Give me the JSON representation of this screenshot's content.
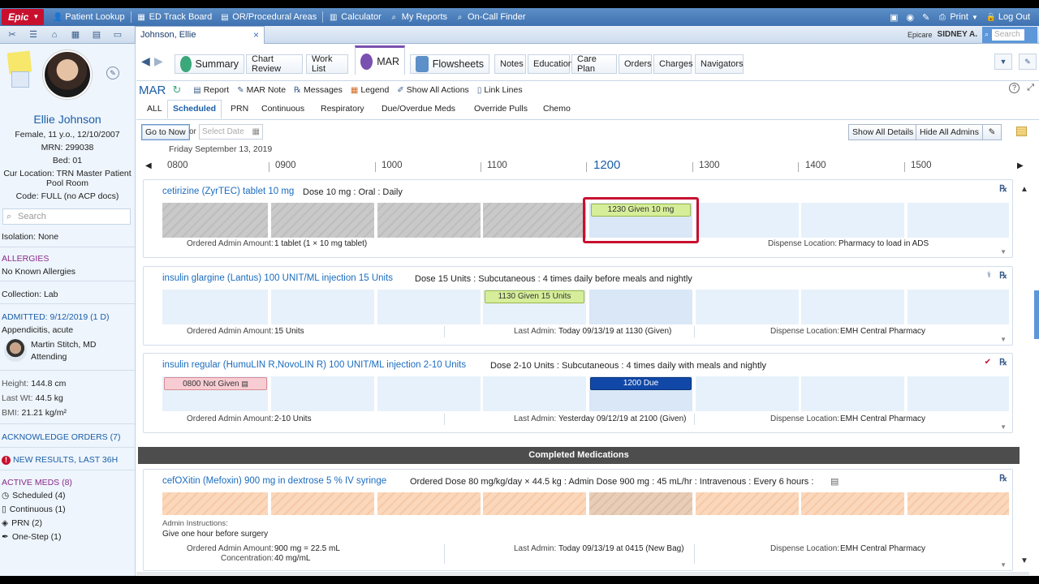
{
  "topbar": {
    "logo": "Epic",
    "items": [
      "Patient Lookup",
      "ED Track Board",
      "OR/Procedural Areas",
      "Calculator",
      "My Reports",
      "On-Call Finder"
    ],
    "print": "Print",
    "logout": "Log Out"
  },
  "tabbar": {
    "patient_tab": "Johnson, Ellie",
    "epicare": "Epicare",
    "user": "SIDNEY A.",
    "search_placeholder": "Search"
  },
  "sidebar": {
    "name": "Ellie Johnson",
    "demographics": "Female, 11 y.o., 12/10/2007",
    "mrn": "MRN: 299038",
    "bed": "Bed: 01",
    "location_line1": "Cur Location: TRN Master Patient",
    "location_line2": "Pool Room",
    "code": "Code: FULL (no ACP docs)",
    "search_placeholder": "Search",
    "isolation": "Isolation: None",
    "allergies_head": "ALLERGIES",
    "allergies": "No Known Allergies",
    "collection": "Collection: Lab",
    "admitted_head": "ADMITTED: 9/12/2019 (1 D)",
    "diagnosis": "Appendicitis, acute",
    "doctor": "Martin Stitch, MD",
    "doctor_role": "Attending",
    "height_label": "Height:",
    "height": "144.8 cm",
    "weight_label": "Last Wt:",
    "weight": "44.5 kg",
    "bmi_label": "BMI:",
    "bmi": "21.21 kg/m²",
    "ack_orders": "ACKNOWLEDGE ORDERS (7)",
    "new_results": "NEW RESULTS, LAST 36H",
    "active_meds_head": "ACTIVE MEDS (8)",
    "active_meds": [
      "Scheduled (4)",
      "Continuous (1)",
      "PRN (2)",
      "One-Step (1)"
    ]
  },
  "activity_tabs": [
    "Summary",
    "Chart Review",
    "Work List",
    "MAR",
    "Flowsheets",
    "Notes",
    "Education",
    "Care Plan",
    "Orders",
    "Charges",
    "Navigators"
  ],
  "mar_toolbar": {
    "title": "MAR",
    "items": [
      "Report",
      "MAR Note",
      "Messages",
      "Legend",
      "Show All Actions",
      "Link Lines"
    ]
  },
  "filter_tabs": [
    "ALL",
    "Scheduled",
    "PRN",
    "Continuous",
    "Respiratory",
    "Due/Overdue Meds",
    "Override Pulls",
    "Chemo"
  ],
  "controls": {
    "go_to_now": "Go to Now",
    "or": "or",
    "select_date": "Select Date",
    "show_all_details": "Show All Details",
    "hide_all_admins": "Hide All Admins"
  },
  "timeline": {
    "date": "Friday September 13, 2019",
    "hours": [
      "0800",
      "0900",
      "1000",
      "1100",
      "1200",
      "1300",
      "1400",
      "1500"
    ],
    "current": "1200"
  },
  "meds": [
    {
      "name": "cetirizine (ZyrTEC) tablet 10 mg",
      "details": "Dose 10 mg  :  Oral  :  Daily",
      "admin": "1230 Given 10 mg",
      "ordered_label": "Ordered Admin Amount:",
      "ordered": "1 tablet (1 × 10 mg tablet)",
      "dispense_label": "Dispense Location:",
      "dispense": "Pharmacy to load in ADS"
    },
    {
      "name": "insulin glargine (Lantus) 100 UNIT/ML injection 15 Units",
      "details": "Dose 15 Units  :  Subcutaneous  :  4 times daily before meals and nightly",
      "admin": "1130 Given 15 Units",
      "ordered_label": "Ordered Admin Amount:",
      "ordered": "15 Units",
      "last_label": "Last Admin:",
      "last": "Today 09/13/19 at 1130  (Given)",
      "dispense_label": "Dispense Location:",
      "dispense": "EMH Central Pharmacy"
    },
    {
      "name": "insulin regular (HumuLIN R,NovoLIN R) 100 UNIT/ML injection 2-10 Units",
      "details": "Dose 2-10 Units  :  Subcutaneous  :  4 times daily with meals and nightly",
      "not_given": "0800 Not Given",
      "due": "1200 Due",
      "ordered_label": "Ordered Admin Amount:",
      "ordered": "2-10 Units",
      "last_label": "Last Admin:",
      "last": "Yesterday 09/12/19 at 2100  (Given)",
      "dispense_label": "Dispense Location:",
      "dispense": "EMH Central Pharmacy"
    }
  ],
  "completed_header": "Completed Medications",
  "completed": {
    "name": "cefOXitin (Mefoxin) 900 mg in dextrose 5 % IV syringe",
    "details": "Ordered Dose 80 mg/kg/day × 44.5 kg  :  Admin Dose 900 mg  :  45 mL/hr  :  Intravenous  :  Every 6 hours  :",
    "instr_label": "Admin Instructions:",
    "instr": "Give one hour before surgery",
    "ordered_label": "Ordered Admin Amount:",
    "ordered": "900 mg = 22.5 mL",
    "conc_label": "Concentration:",
    "conc": "40 mg/mL",
    "last_label": "Last Admin:",
    "last": "Today 09/13/19 at 0415  (New Bag)",
    "dispense_label": "Dispense Location:",
    "dispense": "EMH Central Pharmacy"
  }
}
